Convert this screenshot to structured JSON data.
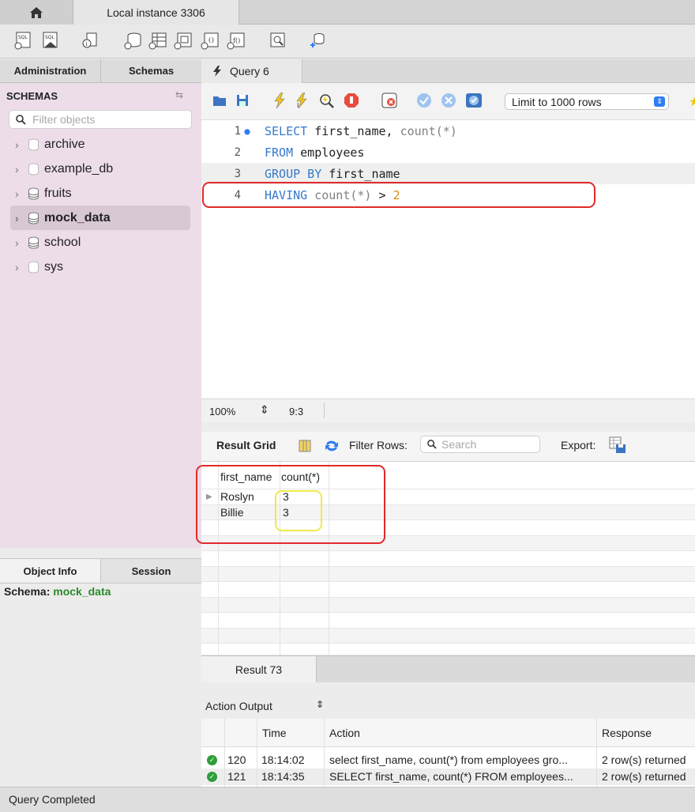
{
  "window": {
    "tab_title": "Local instance 3306"
  },
  "left_panel": {
    "tabs": [
      "Administration",
      "Schemas"
    ],
    "heading": "SCHEMAS",
    "filter_placeholder": "Filter objects",
    "schemas": [
      {
        "name": "archive",
        "selected": false
      },
      {
        "name": "example_db",
        "selected": false
      },
      {
        "name": "fruits",
        "selected": false
      },
      {
        "name": "mock_data",
        "selected": true
      },
      {
        "name": "school",
        "selected": false
      },
      {
        "name": "sys",
        "selected": false
      }
    ],
    "info_tabs": [
      "Object Info",
      "Session"
    ],
    "schema_label": "Schema:",
    "schema_value": "mock_data"
  },
  "query_tab": {
    "label": "Query 6",
    "limit": "Limit to 1000 rows"
  },
  "editor": {
    "lines": [
      {
        "no": "1",
        "kw": "SELECT",
        "rest": " first_name, ",
        "fn": "count(*)",
        "tail": ""
      },
      {
        "no": "2",
        "kw": "FROM",
        "rest": " employees",
        "fn": "",
        "tail": ""
      },
      {
        "no": "3",
        "kw": "GROUP BY",
        "rest": " first_name",
        "fn": "",
        "tail": ""
      },
      {
        "no": "4",
        "kw": "HAVING",
        "rest": " ",
        "fn": "count(*)",
        "tail": " > ",
        "num": "2"
      }
    ],
    "zoom": "100%",
    "cursor": "9:3"
  },
  "result": {
    "label": "Result Grid",
    "filter_label": "Filter Rows:",
    "search_placeholder": "Search",
    "export_label": "Export:",
    "columns": [
      "first_name",
      "count(*)"
    ],
    "rows": [
      [
        "Roslyn",
        "3"
      ],
      [
        "Billie",
        "3"
      ]
    ],
    "result_tab": "Result 73"
  },
  "output": {
    "title": "Action Output",
    "columns": [
      "Time",
      "Action",
      "Response"
    ],
    "rows": [
      {
        "no": "120",
        "time": "18:14:02",
        "action": "select first_name, count(*) from employees gro...",
        "response": "2 row(s) returned"
      },
      {
        "no": "121",
        "time": "18:14:35",
        "action": "SELECT first_name, count(*) FROM employees...",
        "response": "2 row(s) returned"
      }
    ]
  },
  "status": "Query Completed",
  "colors": {
    "keyword": "#3579c9",
    "number": "#d98b13",
    "annotation_red": "#e22a2a",
    "annotation_yellow": "#eeea4a",
    "schema_selected_bg": "#d8c8d4"
  }
}
